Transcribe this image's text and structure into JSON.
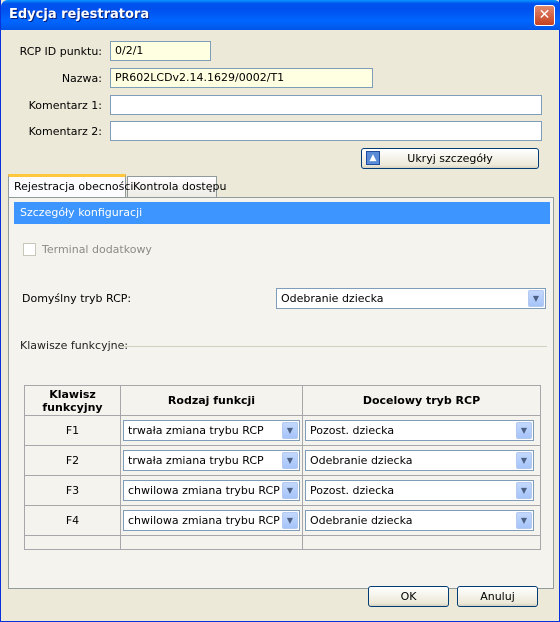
{
  "window": {
    "title": "Edycja rejestratora",
    "close_glyph": "✕"
  },
  "form": {
    "rcp_id_label": "RCP ID punktu:",
    "rcp_id_value": "0/2/1",
    "nazwa_label": "Nazwa:",
    "nazwa_value": "PR602LCDv2.14.1629/0002/T1",
    "komentarz1_label": "Komentarz 1:",
    "komentarz1_value": "",
    "komentarz2_label": "Komentarz 2:",
    "komentarz2_value": "",
    "toggle_details_label": "Ukryj szczegóły"
  },
  "tabs": [
    {
      "label": "Rejestracja obecności",
      "active": true
    },
    {
      "label": "Kontrola dostępu",
      "active": false
    }
  ],
  "panel": {
    "section_title": "Szczegóły konfiguracji",
    "terminal_label": "Terminal dodatkowy",
    "default_mode_label": "Domyślny tryb RCP:",
    "default_mode_value": "Odebranie dziecka",
    "function_keys_label": "Klawisze funkcyjne:",
    "table": {
      "headers": [
        "Klawisz funkcyjny",
        "Rodzaj funkcji",
        "Docelowy tryb RCP"
      ],
      "rows": [
        {
          "key": "F1",
          "function": "trwała zmiana trybu RCP",
          "target": "Pozost. dziecka"
        },
        {
          "key": "F2",
          "function": "trwała zmiana trybu RCP",
          "target": "Odebranie dziecka"
        },
        {
          "key": "F3",
          "function": "chwilowa zmiana trybu RCP",
          "target": "Pozost. dziecka"
        },
        {
          "key": "F4",
          "function": "chwilowa zmiana trybu RCP",
          "target": "Odebranie dziecka"
        }
      ]
    }
  },
  "footer": {
    "ok_label": "OK",
    "cancel_label": "Anuluj"
  },
  "colors": {
    "titlebar": "#0054e3",
    "section_head": "#3d95ff",
    "readonly_field": "#ffffe1"
  }
}
